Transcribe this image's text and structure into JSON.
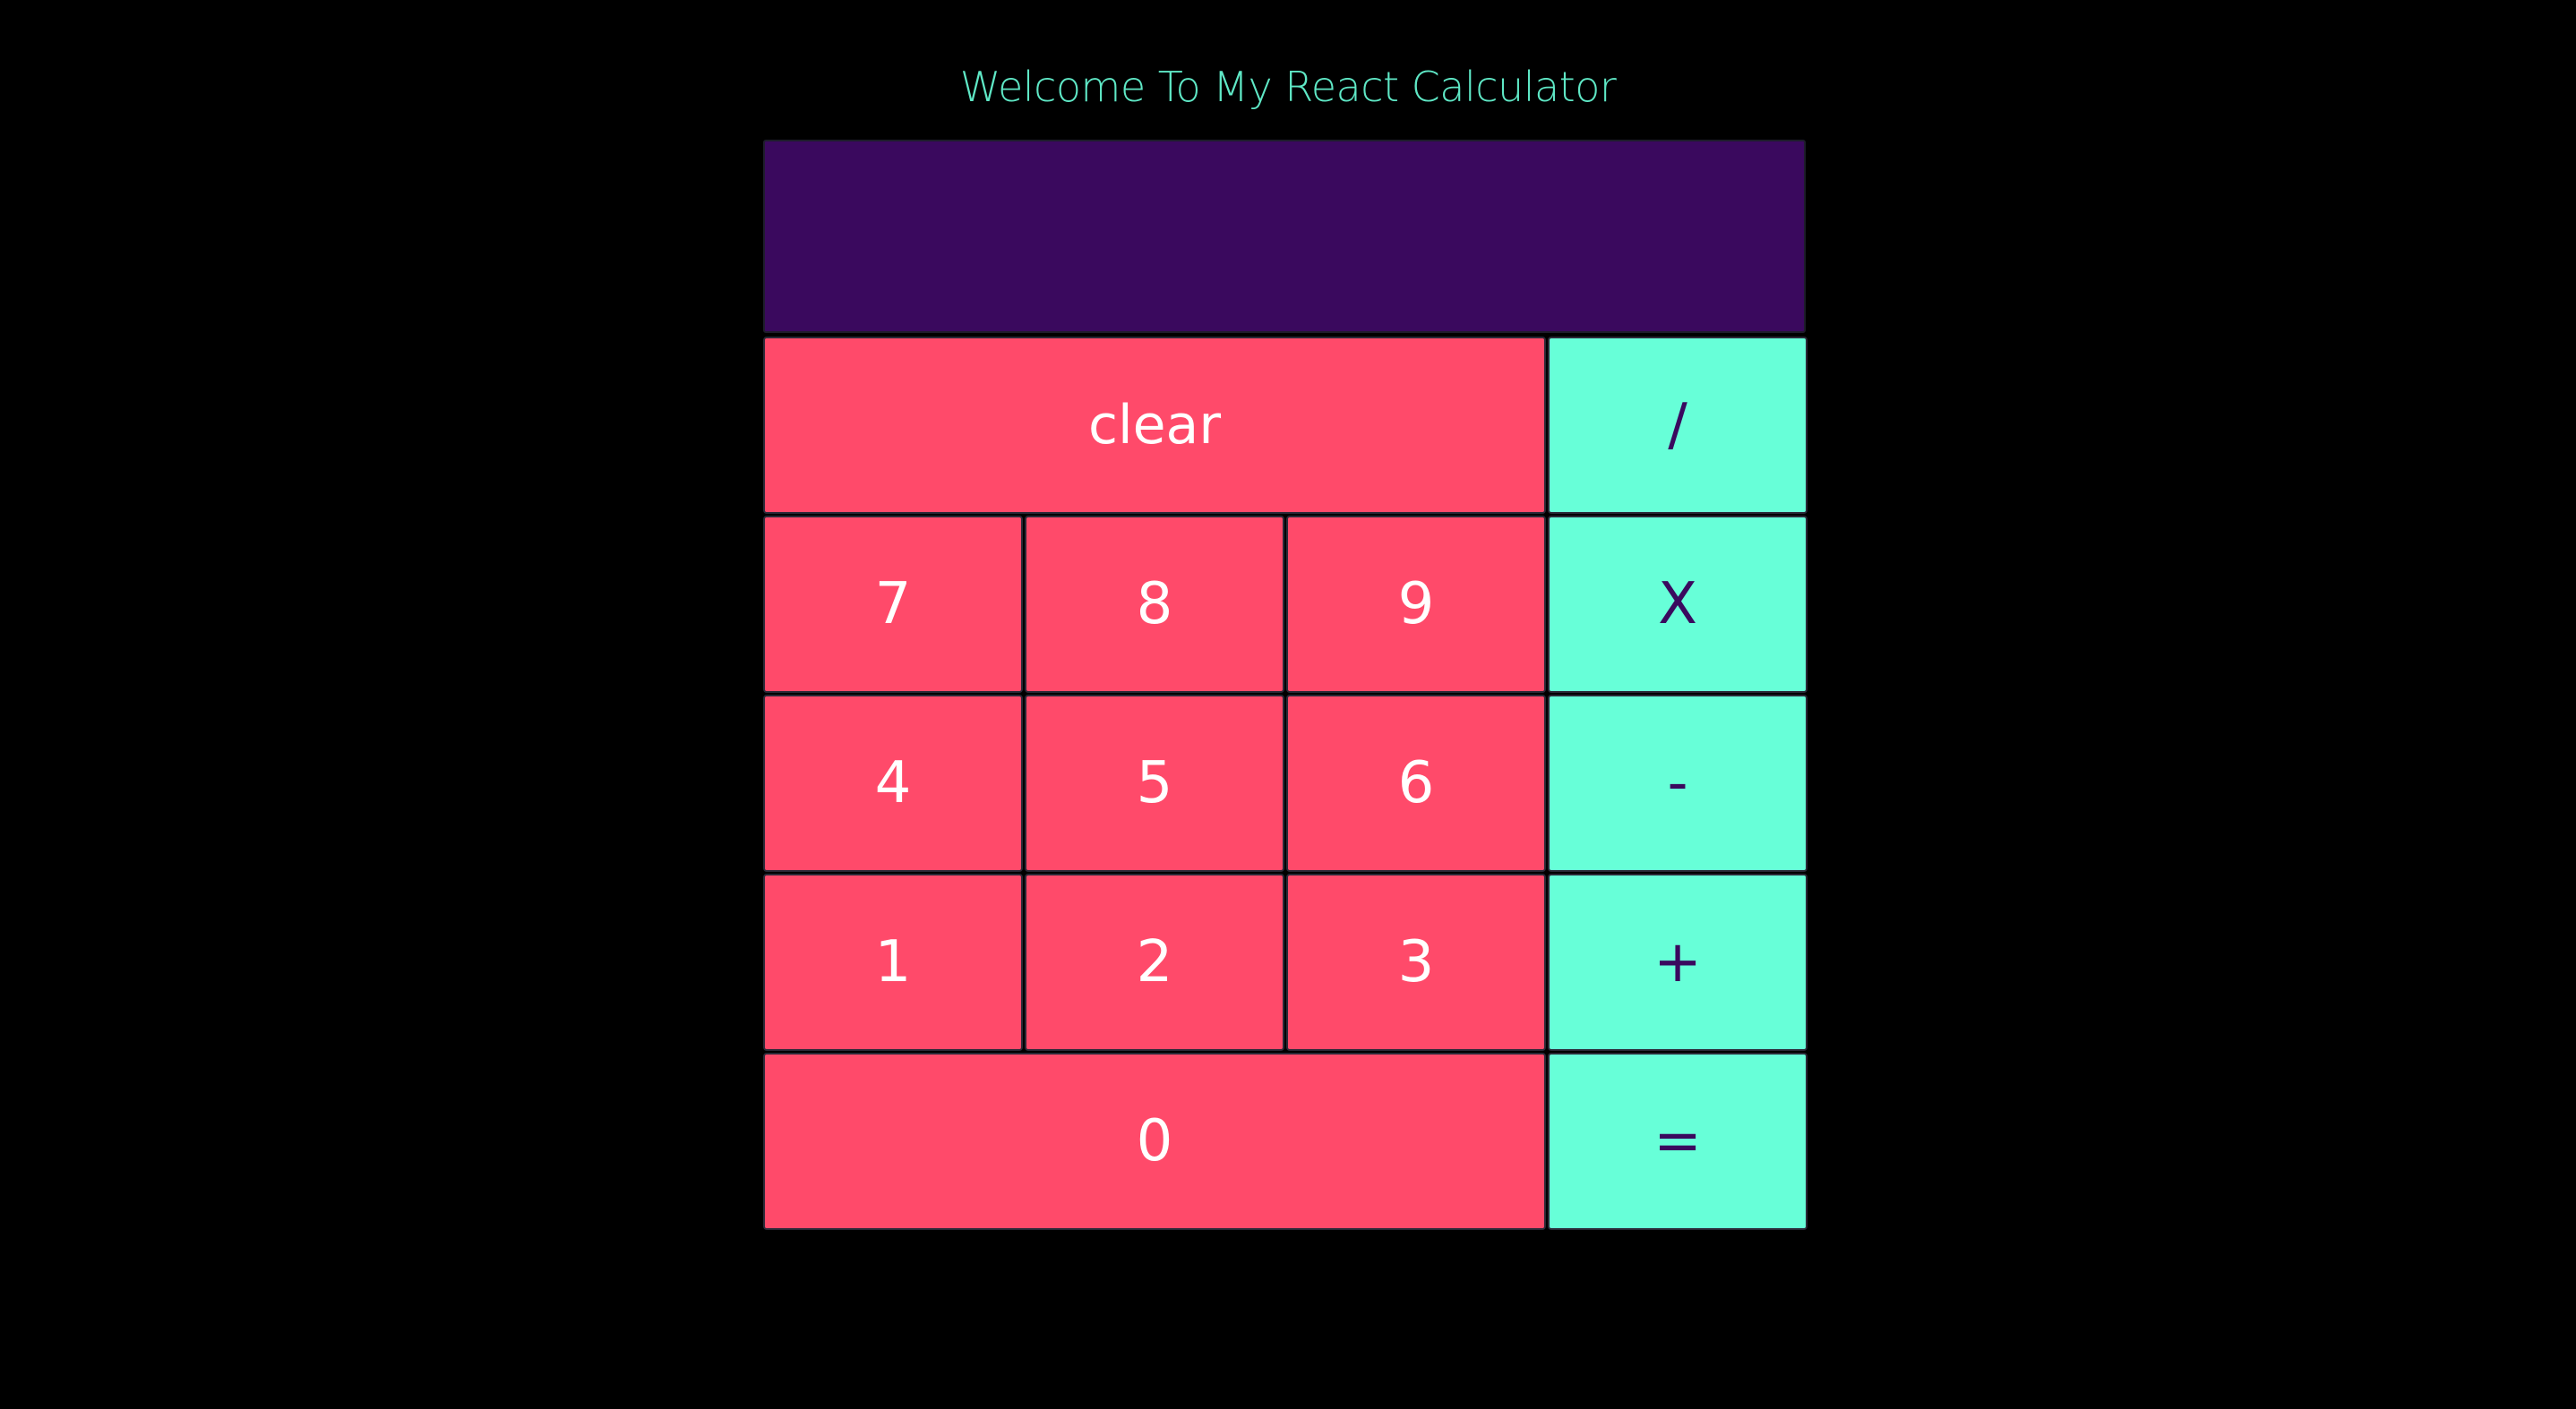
{
  "title": "Welcome To My React Calculator",
  "display": {
    "value": ""
  },
  "buttons": {
    "clear": "clear",
    "divide": "/",
    "seven": "7",
    "eight": "8",
    "nine": "9",
    "multiply": "X",
    "four": "4",
    "five": "5",
    "six": "6",
    "subtract": "-",
    "one": "1",
    "two": "2",
    "three": "3",
    "add": "+",
    "zero": "0",
    "equals": "="
  },
  "colors": {
    "background": "#000000",
    "title": "#5fe8c6",
    "display": "#3a095e",
    "number_button": "#ff4a6a",
    "operator_button": "#67ffd8",
    "operator_text": "#3a095e"
  }
}
